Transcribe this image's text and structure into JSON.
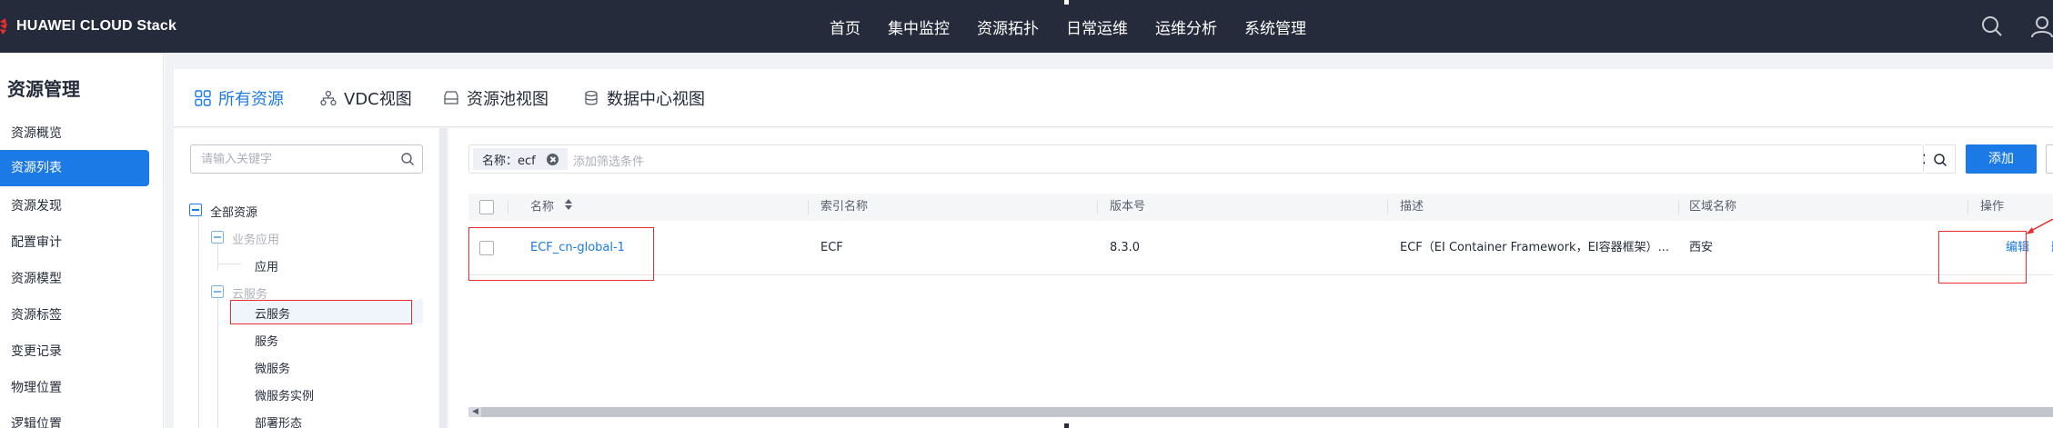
{
  "header": {
    "brand": "HUAWEI CLOUD Stack",
    "nav": [
      "首页",
      "集中监控",
      "资源拓扑",
      "日常运维",
      "运维分析",
      "系统管理"
    ]
  },
  "sidebar": {
    "title": "资源管理",
    "items": [
      {
        "label": "资源概览",
        "active": false
      },
      {
        "label": "资源列表",
        "active": true
      },
      {
        "label": "资源发现",
        "active": false
      },
      {
        "label": "配置审计",
        "active": false
      },
      {
        "label": "资源模型",
        "active": false
      },
      {
        "label": "资源标签",
        "active": false
      },
      {
        "label": "变更记录",
        "active": false
      },
      {
        "label": "物理位置",
        "active": false
      },
      {
        "label": "逻辑位置",
        "active": false
      }
    ]
  },
  "tabs": [
    {
      "label": "所有资源",
      "icon": "grid-icon",
      "active": true
    },
    {
      "label": "VDC视图",
      "icon": "org-tree-icon",
      "active": false
    },
    {
      "label": "资源池视图",
      "icon": "storage-icon",
      "active": false
    },
    {
      "label": "数据中心视图",
      "icon": "database-icon",
      "active": false
    }
  ],
  "tree": {
    "search_placeholder": "请输入关键字",
    "nodes": {
      "all": "全部资源",
      "business_app": "业务应用",
      "app": "应用",
      "cloud_service_group": "云服务",
      "cloud_service": "云服务",
      "service": "服务",
      "micro_service": "微服务",
      "micro_service_instance": "微服务实例",
      "cut_off": "部署形态"
    }
  },
  "filter": {
    "chip": "名称：ecf",
    "placeholder": "添加筛选条件",
    "add_label": "添加"
  },
  "table": {
    "columns": [
      "名称",
      "索引名称",
      "版本号",
      "描述",
      "区域名称",
      "操作"
    ],
    "rows": [
      {
        "name": "ECF_cn-global-1",
        "index_name": "ECF",
        "version": "8.3.0",
        "description": "ECF（EI Container Framework，EI容器框架）...",
        "region": "西安",
        "actions": [
          "编辑",
          "删除"
        ]
      }
    ]
  },
  "colors": {
    "topbar": "#252b3a",
    "accent": "#1c7ae6",
    "annotation": "#e62e2e"
  }
}
